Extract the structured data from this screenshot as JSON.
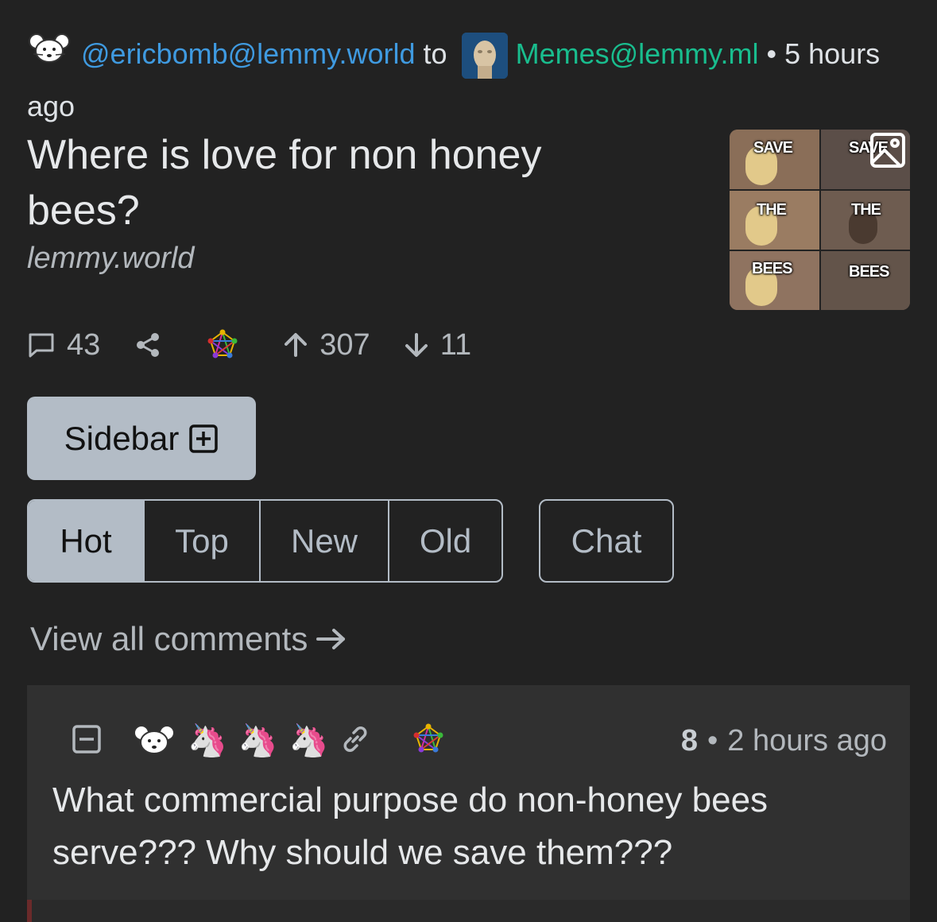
{
  "post": {
    "author": "@ericbomb@lemmy.world",
    "to_word": "to",
    "community": "Memes@lemmy.ml",
    "separator": "•",
    "time": "5 hours ago",
    "title": "Where is love for non honey bees?",
    "domain": "lemmy.world",
    "thumbnail_captions": [
      "SAVE",
      "SAVE",
      "THE",
      "THE",
      "BEES",
      "BEES"
    ],
    "comments_count": "43",
    "upvotes": "307",
    "downvotes": "11"
  },
  "sidebar_button": {
    "label": "Sidebar"
  },
  "sort_tabs": [
    {
      "label": "Hot",
      "active": true
    },
    {
      "label": "Top",
      "active": false
    },
    {
      "label": "New",
      "active": false
    },
    {
      "label": "Old",
      "active": false
    }
  ],
  "chat_button": {
    "label": "Chat"
  },
  "view_all_comments": {
    "label": "View all comments"
  },
  "comment": {
    "emojis": [
      "🦄",
      "🦄",
      "🦄"
    ],
    "score": "8",
    "separator": "•",
    "time": "2 hours ago",
    "text": "What commercial purpose do non-honey bees serve??? Why should we save them???"
  },
  "colors": {
    "background": "#222222",
    "user_link": "#3f9ae0",
    "community_link": "#19bd8e",
    "button_bg": "#b3bcc6"
  }
}
